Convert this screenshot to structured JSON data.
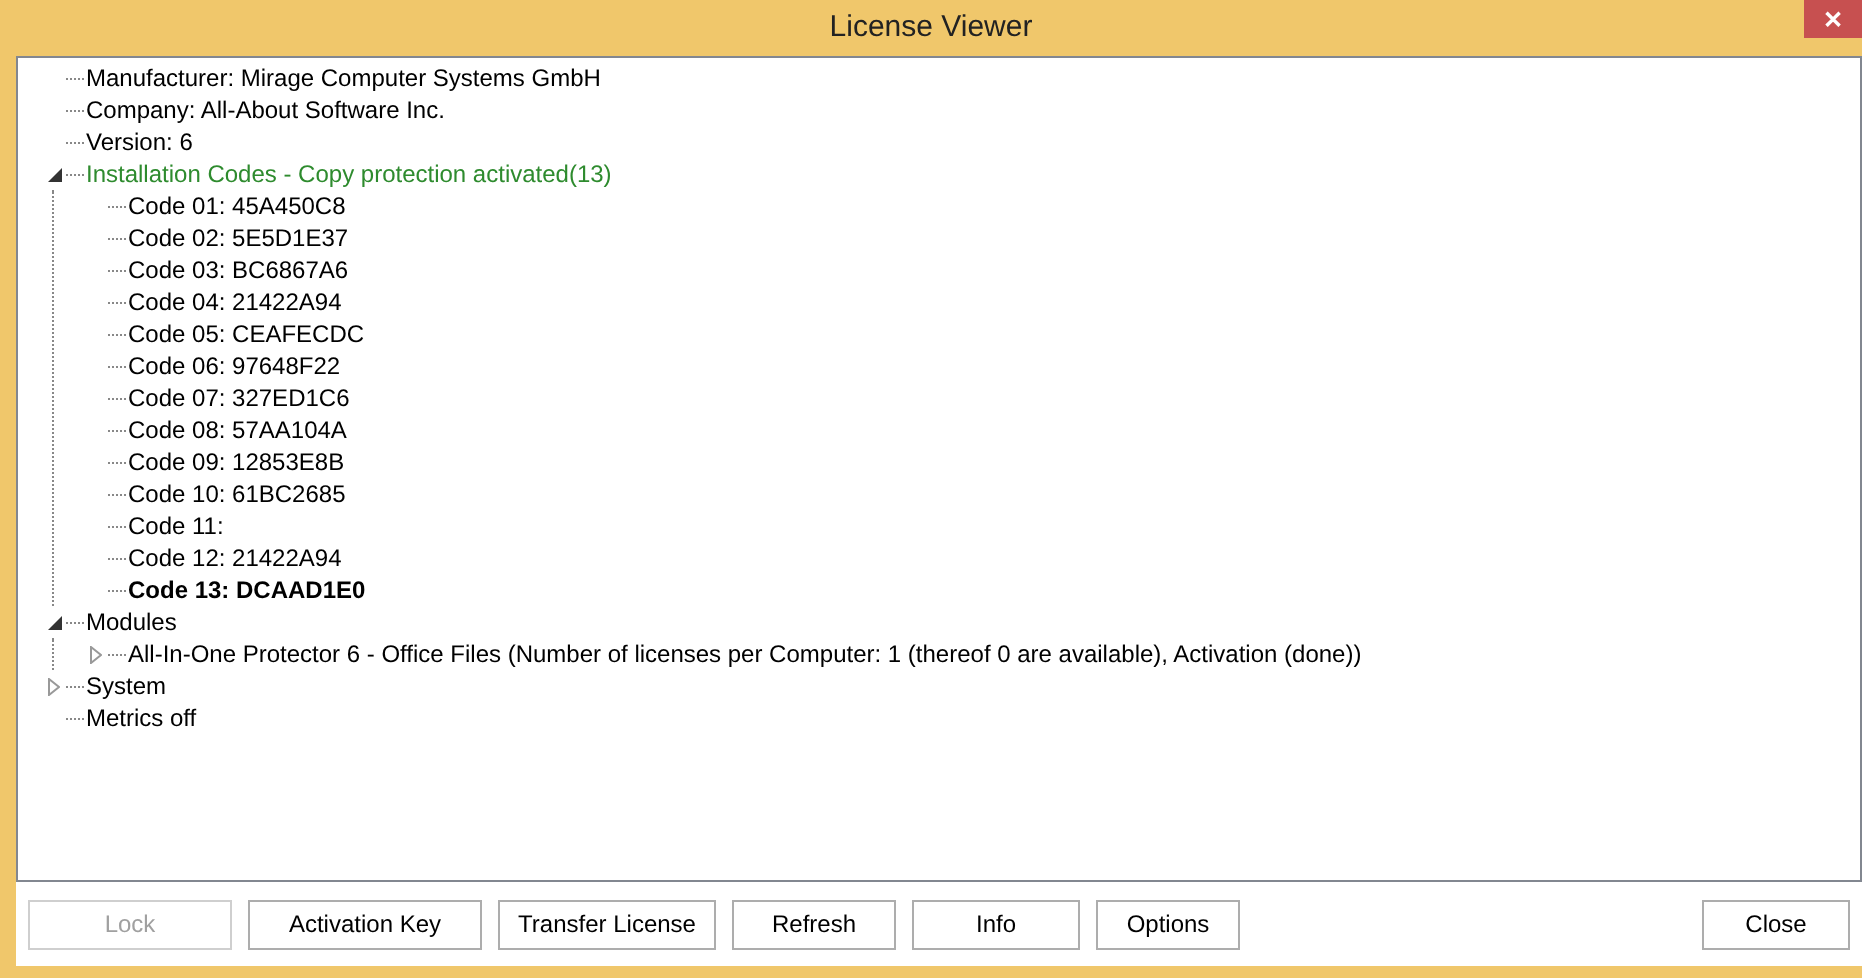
{
  "window": {
    "title": "License Viewer",
    "close": "✕"
  },
  "tree": [
    {
      "label": "Manufacturer: Mirage Computer Systems GmbH"
    },
    {
      "label": "Company: All-About Software Inc."
    },
    {
      "label": "Version: 6"
    },
    {
      "label": "Installation Codes - Copy protection activated(13)",
      "color": "#2e8b2e",
      "expanded": true,
      "children": [
        {
          "label": "Code 01: 45A450C8"
        },
        {
          "label": "Code 02: 5E5D1E37"
        },
        {
          "label": "Code 03: BC6867A6"
        },
        {
          "label": "Code 04: 21422A94"
        },
        {
          "label": "Code 05: CEAFECDC"
        },
        {
          "label": "Code 06: 97648F22"
        },
        {
          "label": "Code 07: 327ED1C6"
        },
        {
          "label": "Code 08: 57AA104A"
        },
        {
          "label": "Code 09: 12853E8B"
        },
        {
          "label": "Code 10: 61BC2685"
        },
        {
          "label": "Code 11:"
        },
        {
          "label": "Code 12: 21422A94"
        },
        {
          "label": "Code 13: DCAAD1E0",
          "bold": true
        }
      ]
    },
    {
      "label": "Modules",
      "expanded": true,
      "children": [
        {
          "label": "All-In-One Protector 6 - Office Files (Number of licenses per Computer: 1 (thereof 0 are available), Activation (done))",
          "expanded": false
        }
      ]
    },
    {
      "label": "System",
      "expanded": false
    },
    {
      "label": "Metrics off"
    }
  ],
  "buttons": [
    {
      "label": "Lock",
      "disabled": true
    },
    {
      "label": "Activation Key",
      "disabled": false
    },
    {
      "label": "Transfer License",
      "disabled": false
    },
    {
      "label": "Refresh",
      "disabled": false
    },
    {
      "label": "Info",
      "disabled": false
    },
    {
      "label": "Options",
      "disabled": false
    }
  ],
  "close_button": {
    "label": "Close"
  }
}
